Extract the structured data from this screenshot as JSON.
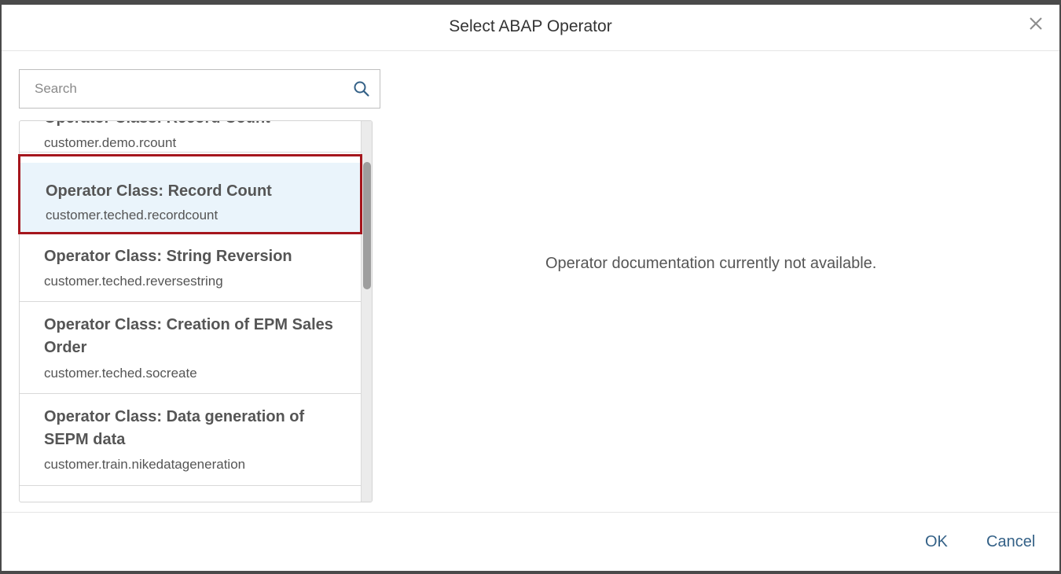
{
  "dialog": {
    "title": "Select ABAP Operator",
    "close_icon": "close-icon"
  },
  "search": {
    "placeholder": "Search",
    "value": "",
    "icon": "search-icon"
  },
  "list": {
    "items": [
      {
        "title": "Operator Class: Record Count",
        "subtitle": "customer.demo.rcount",
        "selected": false,
        "partially_visible": true
      },
      {
        "title": "Operator Class: Record Count",
        "subtitle": "customer.teched.recordcount",
        "selected": true
      },
      {
        "title": "Operator Class: String Reversion",
        "subtitle": "customer.teched.reversestring",
        "selected": false
      },
      {
        "title": "Operator Class: Creation of EPM Sales Order",
        "subtitle": "customer.teched.socreate",
        "selected": false
      },
      {
        "title": "Operator Class: Data generation of SEPM data",
        "subtitle": "customer.train.nikedatageneration",
        "selected": false
      }
    ]
  },
  "documentation": {
    "message": "Operator documentation currently not available."
  },
  "footer": {
    "ok_label": "OK",
    "cancel_label": "Cancel"
  },
  "colors": {
    "accent": "#346187",
    "selection_bg": "#eaf4fb",
    "highlight_border": "#a5161d"
  }
}
